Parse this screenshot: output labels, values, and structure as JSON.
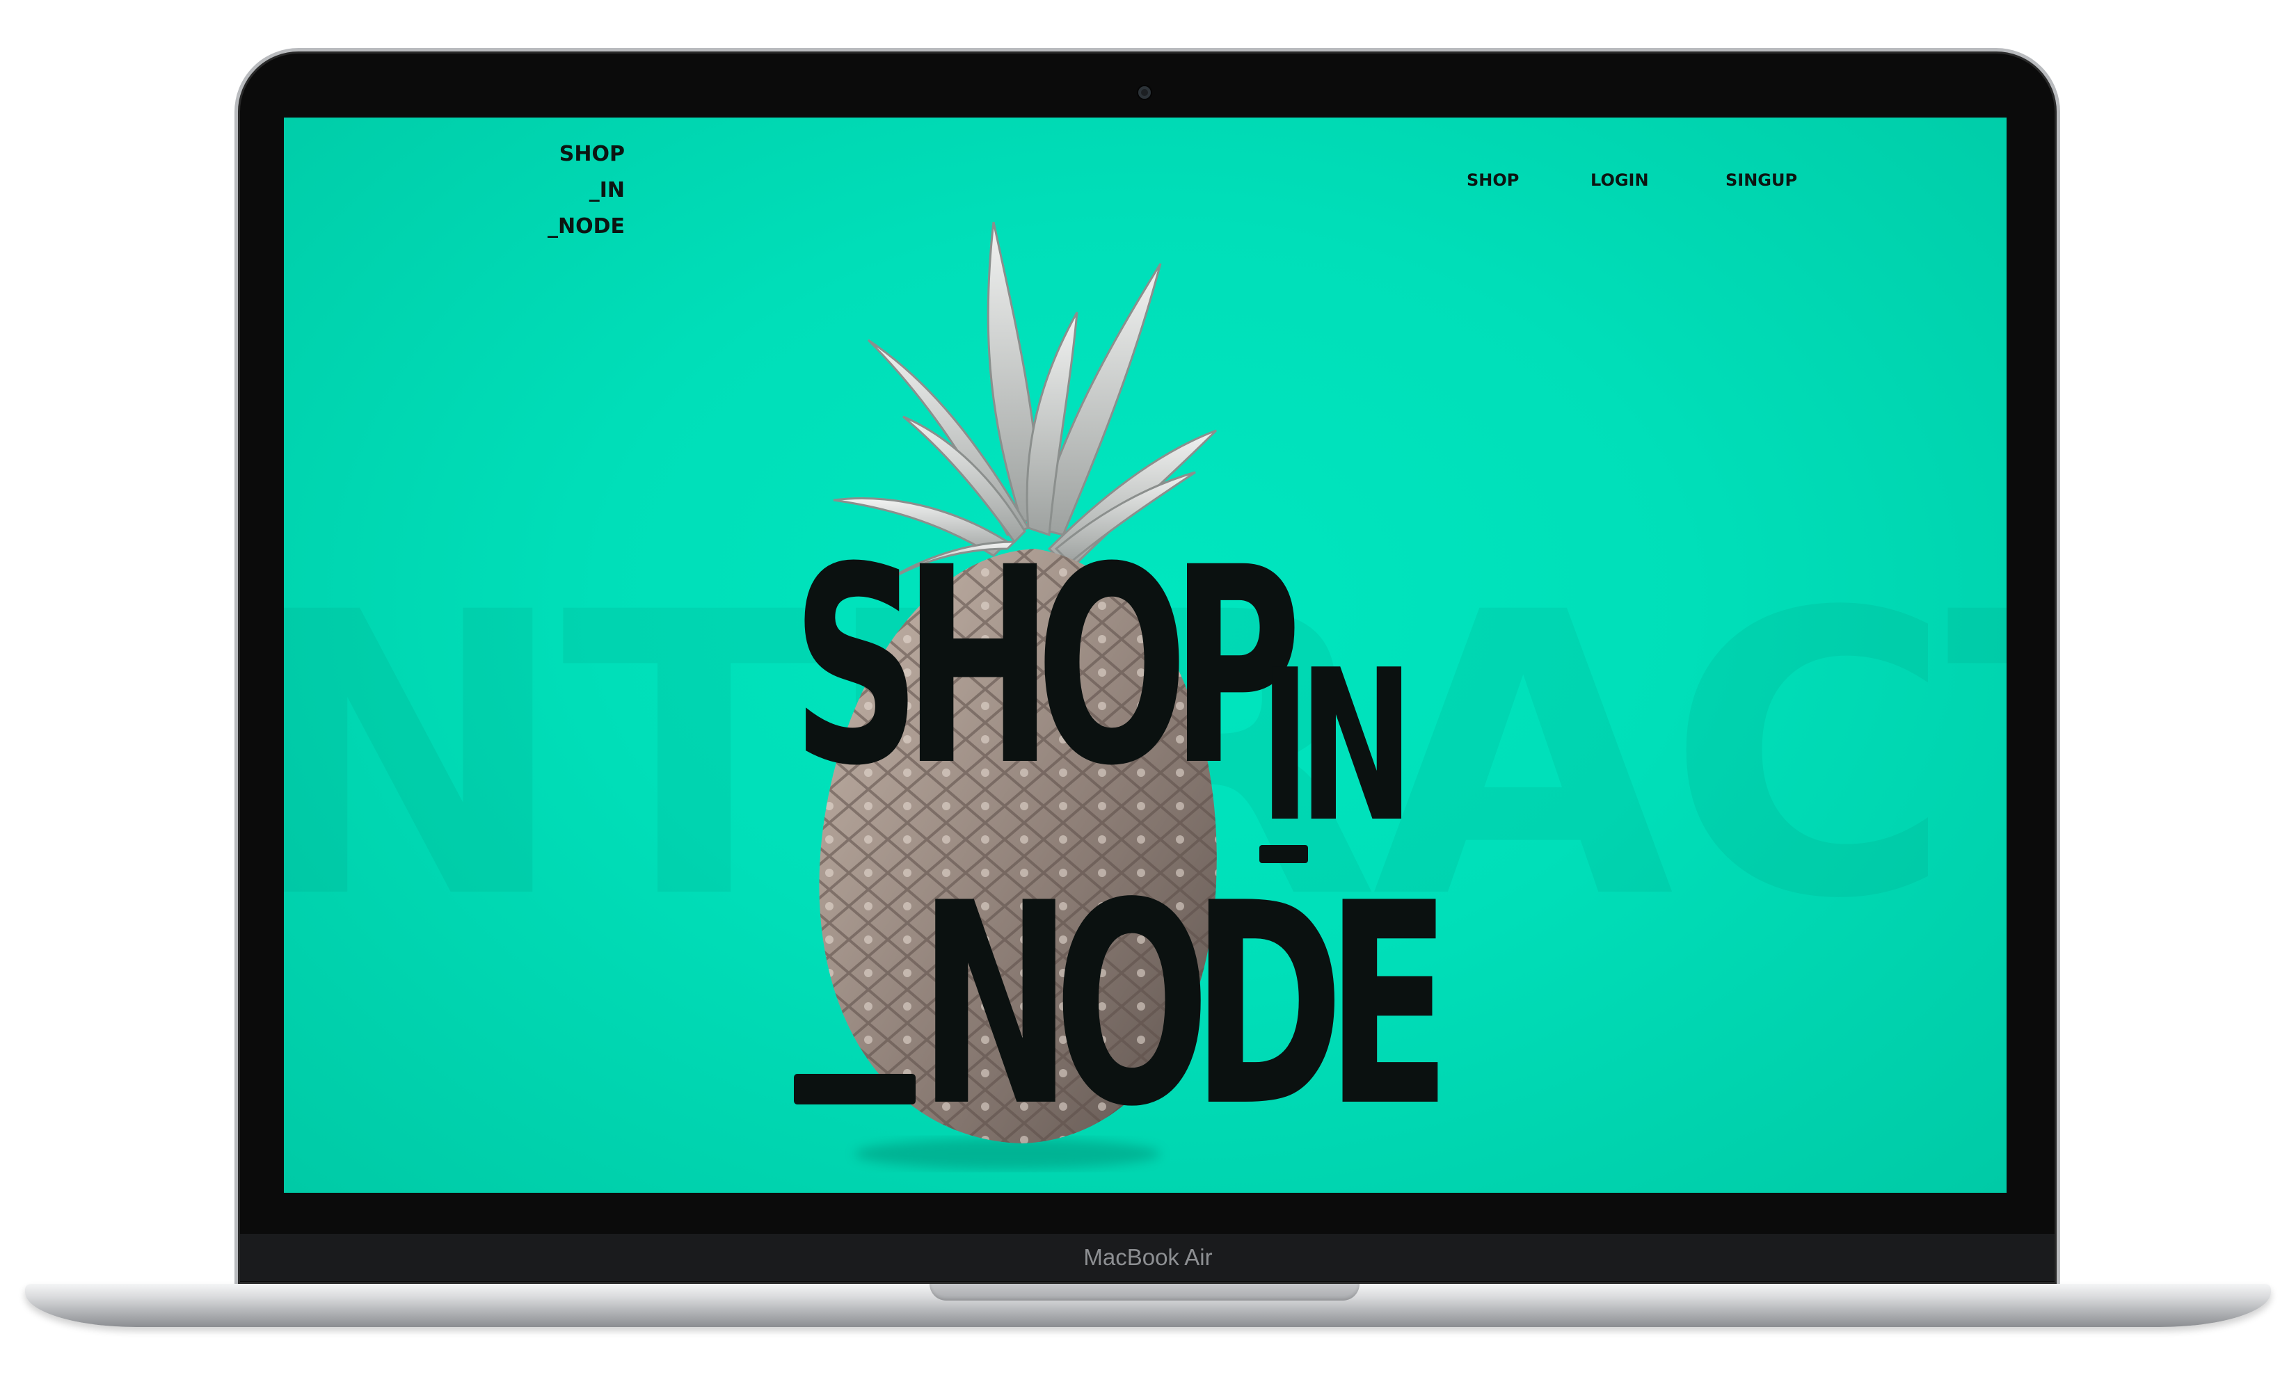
{
  "device": {
    "label": "MacBook Air"
  },
  "site": {
    "logo_lines": [
      "SHOP",
      "_IN",
      "_NODE"
    ],
    "nav": [
      {
        "label": "SHOP"
      },
      {
        "label": "LOGIN"
      },
      {
        "label": "SINGUP"
      }
    ],
    "hero": {
      "line1": "SHOP",
      "line2": "IN",
      "line3": "NODE"
    },
    "background_word": "NTERACTI",
    "colors": {
      "accent": "#00dfb9",
      "text": "#0b1110"
    },
    "image_subject": "pineapple"
  }
}
